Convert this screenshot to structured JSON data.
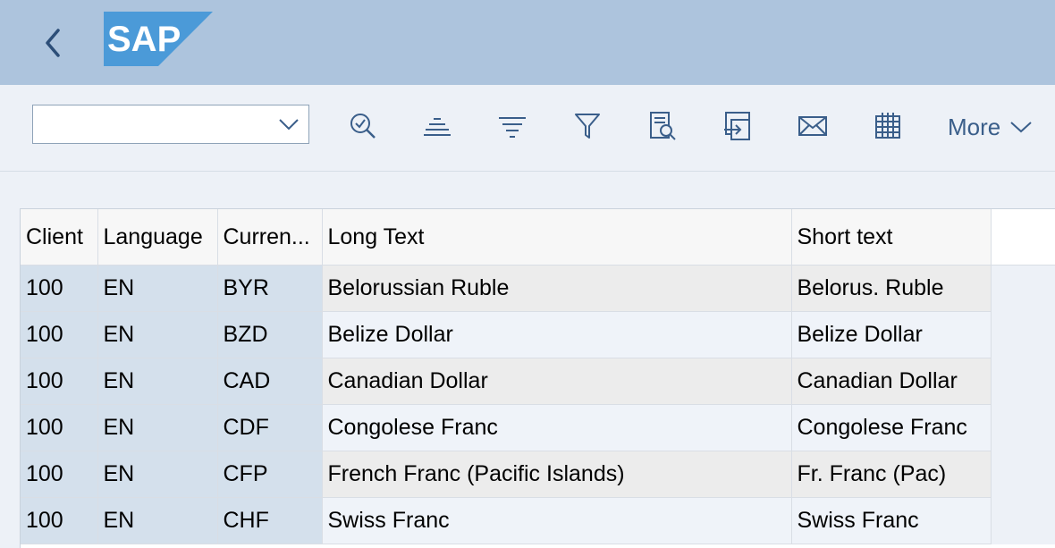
{
  "shell": {
    "logo_text": "SAP",
    "back_icon": "chevron-left-icon",
    "colors": {
      "shellbar": "#adc4dd",
      "logo": "#4b9ad8",
      "accent": "#3a5e8a"
    }
  },
  "toolbar": {
    "layout_select_value": "",
    "icons": [
      "search-icon",
      "align-center-icon",
      "sort-icon",
      "filter-icon",
      "print-preview-icon",
      "export-icon",
      "mail-icon",
      "spreadsheet-icon"
    ],
    "more_label": "More"
  },
  "table": {
    "columns": [
      "Client",
      "Language",
      "Curren...",
      "Long Text",
      "Short text"
    ],
    "rows": [
      {
        "client": "100",
        "language": "EN",
        "currency": "BYR",
        "long_text": "Belorussian Ruble",
        "short_text": "Belorus. Ruble"
      },
      {
        "client": "100",
        "language": "EN",
        "currency": "BZD",
        "long_text": "Belize Dollar",
        "short_text": "Belize Dollar"
      },
      {
        "client": "100",
        "language": "EN",
        "currency": "CAD",
        "long_text": "Canadian Dollar",
        "short_text": "Canadian Dollar"
      },
      {
        "client": "100",
        "language": "EN",
        "currency": "CDF",
        "long_text": "Congolese Franc",
        "short_text": "Congolese Franc"
      },
      {
        "client": "100",
        "language": "EN",
        "currency": "CFP",
        "long_text": "French Franc (Pacific Islands)",
        "short_text": "Fr. Franc (Pac)"
      },
      {
        "client": "100",
        "language": "EN",
        "currency": "CHF",
        "long_text": "Swiss Franc",
        "short_text": "Swiss Franc"
      }
    ]
  }
}
